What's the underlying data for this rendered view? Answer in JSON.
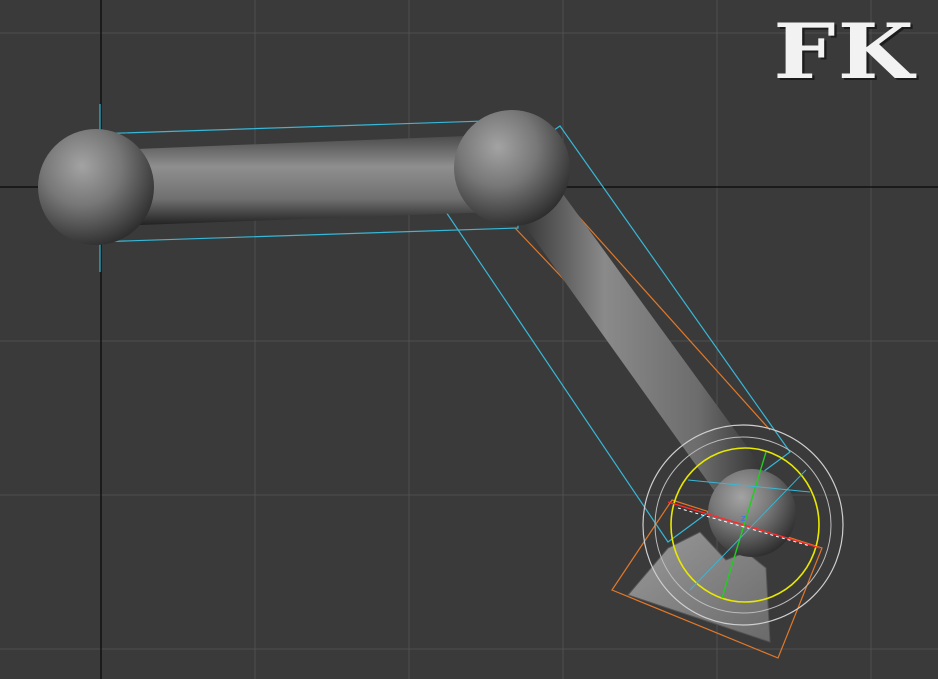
{
  "viewport": {
    "mode_label": "FK",
    "grid_on": true,
    "colors": {
      "background": "#3a3a3a",
      "grid_line": "#4f4f4f",
      "world_axis": "#111111",
      "bone_envelope": "#38b7d6",
      "bone_outline": "#e0782a",
      "rotate_gizmo_ring": "#e8e800",
      "rotate_gizmo_outer": "#cfcfcf",
      "axis_x": "#ff2a2a",
      "axis_y": "#22cc22",
      "axis_z": "#3a6cff"
    }
  },
  "rig": {
    "joints": [
      "shoulder-joint",
      "elbow-joint",
      "wrist-joint"
    ],
    "bones": [
      "upper-arm-bone",
      "forearm-bone",
      "hand-bone"
    ],
    "selected": "wrist-joint",
    "gizmo": "rotate",
    "gizmo_axis_label": "z"
  }
}
